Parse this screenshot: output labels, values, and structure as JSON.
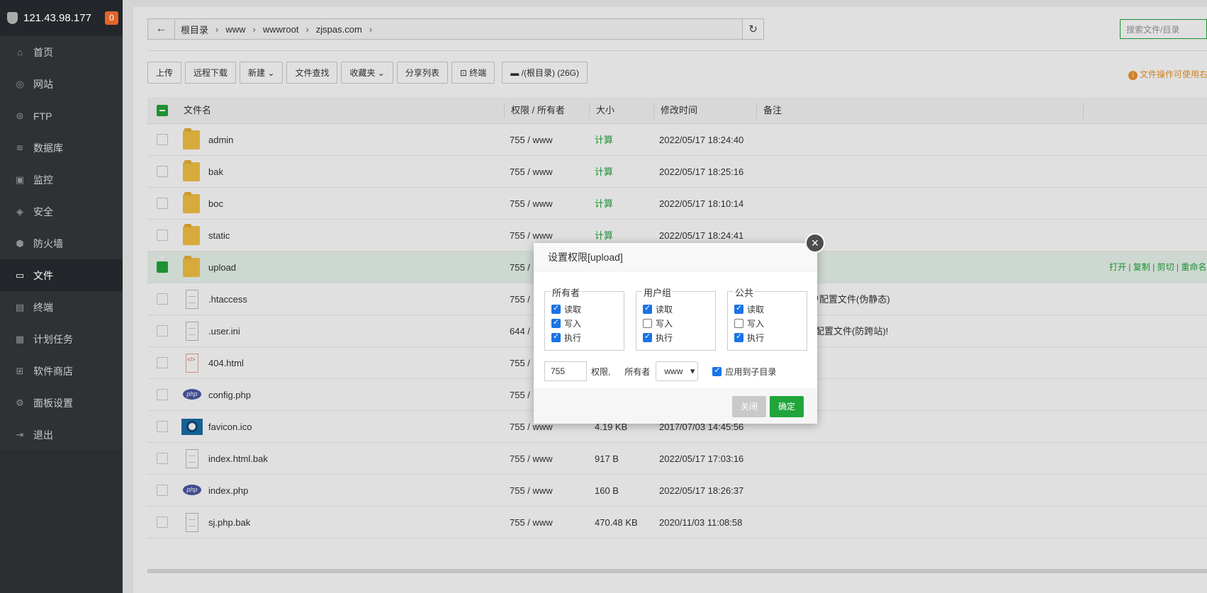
{
  "sidebar": {
    "server_ip": "121.43.98.177",
    "badge": "0",
    "items": [
      {
        "label": "首页",
        "icon": "home-icon"
      },
      {
        "label": "网站",
        "icon": "globe-icon"
      },
      {
        "label": "FTP",
        "icon": "ftp-icon"
      },
      {
        "label": "数据库",
        "icon": "database-icon"
      },
      {
        "label": "监控",
        "icon": "monitor-icon"
      },
      {
        "label": "安全",
        "icon": "shield-icon"
      },
      {
        "label": "防火墙",
        "icon": "firewall-icon"
      },
      {
        "label": "文件",
        "icon": "folder-icon"
      },
      {
        "label": "终端",
        "icon": "terminal-icon"
      },
      {
        "label": "计划任务",
        "icon": "calendar-icon"
      },
      {
        "label": "软件商店",
        "icon": "grid-icon"
      },
      {
        "label": "面板设置",
        "icon": "gear-icon"
      },
      {
        "label": "退出",
        "icon": "logout-icon"
      }
    ],
    "active_index": 7
  },
  "path": {
    "crumbs": [
      "根目录",
      "www",
      "wwwroot",
      "zjspas.com"
    ],
    "search_placeholder": "搜索文件/目录"
  },
  "toolbar": {
    "buttons": [
      "上传",
      "远程下载",
      "新建",
      "文件查找",
      "收藏夹",
      "分享列表",
      "终端",
      "/(根目录) (26G)"
    ],
    "tip": "文件操作可使用右"
  },
  "table": {
    "headers": {
      "name": "文件名",
      "perm": "权限 / 所有者",
      "size": "大小",
      "mtime": "修改时间",
      "note": "备注"
    },
    "rows": [
      {
        "name": "admin",
        "perm": "755 / www",
        "size": "计算",
        "mtime": "2022/05/17 18:24:40",
        "note": "",
        "type": "folder"
      },
      {
        "name": "bak",
        "perm": "755 / www",
        "size": "计算",
        "mtime": "2022/05/17 18:25:16",
        "note": "",
        "type": "folder"
      },
      {
        "name": "boc",
        "perm": "755 / www",
        "size": "计算",
        "mtime": "2022/05/17 18:10:14",
        "note": "",
        "type": "folder"
      },
      {
        "name": "static",
        "perm": "755 / www",
        "size": "计算",
        "mtime": "2022/05/17 18:24:41",
        "note": "",
        "type": "folder"
      },
      {
        "name": "upload",
        "perm": "755 /",
        "size": "",
        "mtime": "",
        "note": "",
        "type": "folder",
        "selected": true
      },
      {
        "name": ".htaccess",
        "perm": "755 /",
        "size": "",
        "mtime": "",
        "note": "户配置文件(伪静态)",
        "type": "doc"
      },
      {
        "name": ".user.ini",
        "perm": "644 /",
        "size": "",
        "mtime": "",
        "note": "配置文件(防跨站)!",
        "type": "doc"
      },
      {
        "name": "404.html",
        "perm": "755 /",
        "size": "",
        "mtime": "",
        "note": "",
        "type": "html"
      },
      {
        "name": "config.php",
        "perm": "755 /",
        "size": "",
        "mtime": "",
        "note": "",
        "type": "php"
      },
      {
        "name": "favicon.ico",
        "perm": "755 / www",
        "size": "4.19 KB",
        "mtime": "2017/07/03 14:45:56",
        "note": "",
        "type": "ico"
      },
      {
        "name": "index.html.bak",
        "perm": "755 / www",
        "size": "917 B",
        "mtime": "2022/05/17 17:03:16",
        "note": "",
        "type": "doc"
      },
      {
        "name": "index.php",
        "perm": "755 / www",
        "size": "160 B",
        "mtime": "2022/05/17 18:26:37",
        "note": "",
        "type": "php"
      },
      {
        "name": "sj.php.bak",
        "perm": "755 / www",
        "size": "470.48 KB",
        "mtime": "2020/11/03 11:08:58",
        "note": "",
        "type": "doc"
      }
    ],
    "row_ops": "打开 | 复制 | 剪切 | 重命名"
  },
  "dialog": {
    "title": "设置权限[upload]",
    "groups": [
      {
        "label": "所有者",
        "opts": [
          {
            "label": "读取",
            "checked": true
          },
          {
            "label": "写入",
            "checked": true
          },
          {
            "label": "执行",
            "checked": true
          }
        ]
      },
      {
        "label": "用户组",
        "opts": [
          {
            "label": "读取",
            "checked": true
          },
          {
            "label": "写入",
            "checked": false
          },
          {
            "label": "执行",
            "checked": true
          }
        ]
      },
      {
        "label": "公共",
        "opts": [
          {
            "label": "读取",
            "checked": true
          },
          {
            "label": "写入",
            "checked": false
          },
          {
            "label": "执行",
            "checked": true
          }
        ]
      }
    ],
    "perm_value": "755",
    "perm_label": "权限,",
    "owner_label": "所有者",
    "owner_value": "www",
    "apply_sub": "应用到子目录",
    "close_btn": "关闭",
    "ok_btn": "确定"
  },
  "colors": {
    "accent": "#20a53a",
    "sidebar": "#2f3235",
    "warning": "#f0952a"
  }
}
